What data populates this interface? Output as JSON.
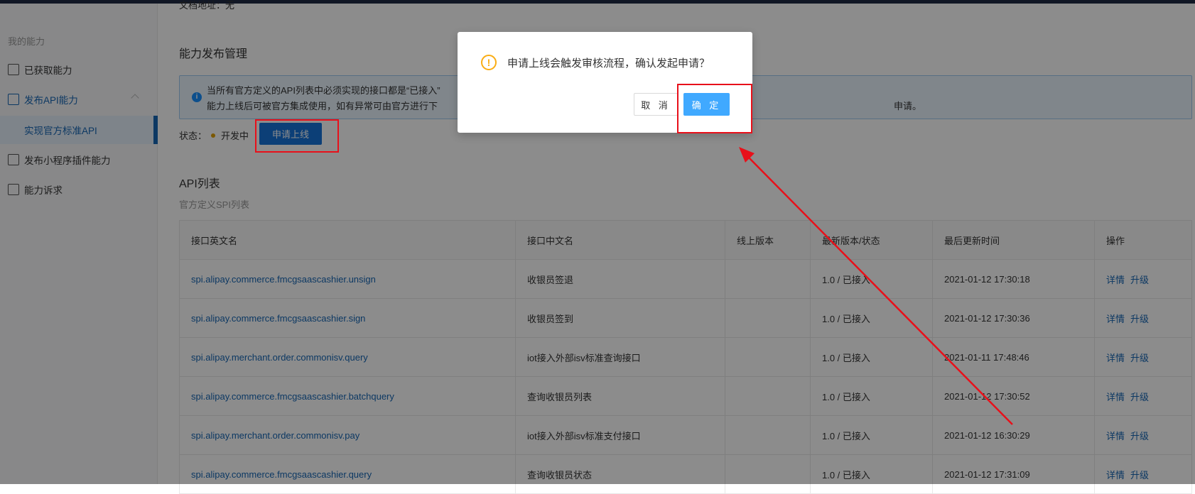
{
  "sidebar": {
    "title": "我的能力",
    "items": [
      {
        "label": "已获取能力"
      },
      {
        "label": "发布API能力"
      },
      {
        "label": "实现官方标准API"
      },
      {
        "label": "发布小程序插件能力"
      },
      {
        "label": "能力诉求"
      }
    ]
  },
  "main": {
    "doc_address": "文档地址：无",
    "section_title": "能力发布管理",
    "alert_line1": "当所有官方定义的API列表中必须实现的接口都是“已接入”",
    "alert_line2": "能力上线后可被官方集成使用，如有异常可由官方进行下",
    "alert_tail": "申请。",
    "status_label": "状态：",
    "status_value": "开发中",
    "apply_button": "申请上线",
    "api_title": "API列表",
    "api_subtitle": "官方定义SPI列表",
    "columns": [
      "接口英文名",
      "接口中文名",
      "线上版本",
      "最新版本/状态",
      "最后更新时间",
      "操作"
    ],
    "rows": [
      {
        "en": "spi.alipay.commerce.fmcgsaascashier.unsign",
        "cn": "收银员签退",
        "online": "",
        "latest": "1.0 / 已接入",
        "time": "2021-01-12 17:30:18",
        "op1": "详情",
        "op2": "升级"
      },
      {
        "en": "spi.alipay.commerce.fmcgsaascashier.sign",
        "cn": "收银员签到",
        "online": "",
        "latest": "1.0 / 已接入",
        "time": "2021-01-12 17:30:36",
        "op1": "详情",
        "op2": "升级"
      },
      {
        "en": "spi.alipay.merchant.order.commonisv.query",
        "cn": "iot接入外部isv标准查询接口",
        "online": "",
        "latest": "1.0 / 已接入",
        "time": "2021-01-11 17:48:46",
        "op1": "详情",
        "op2": "升级"
      },
      {
        "en": "spi.alipay.commerce.fmcgsaascashier.batchquery",
        "cn": "查询收银员列表",
        "online": "",
        "latest": "1.0 / 已接入",
        "time": "2021-01-12 17:30:52",
        "op1": "详情",
        "op2": "升级"
      },
      {
        "en": "spi.alipay.merchant.order.commonisv.pay",
        "cn": "iot接入外部isv标准支付接口",
        "online": "",
        "latest": "1.0 / 已接入",
        "time": "2021-01-12 16:30:29",
        "op1": "详情",
        "op2": "升级"
      },
      {
        "en": "spi.alipay.commerce.fmcgsaascashier.query",
        "cn": "查询收银员状态",
        "online": "",
        "latest": "1.0 / 已接入",
        "time": "2021-01-12 17:31:09",
        "op1": "详情",
        "op2": "升级"
      }
    ]
  },
  "dialog": {
    "message": "申请上线会触发审核流程，确认发起申请？",
    "cancel": "取 消",
    "ok": "确 定"
  },
  "colors": {
    "accent": "#1767b5",
    "annotation": "#e8101a",
    "warning": "#faad14",
    "primary": "#40a9ff"
  }
}
